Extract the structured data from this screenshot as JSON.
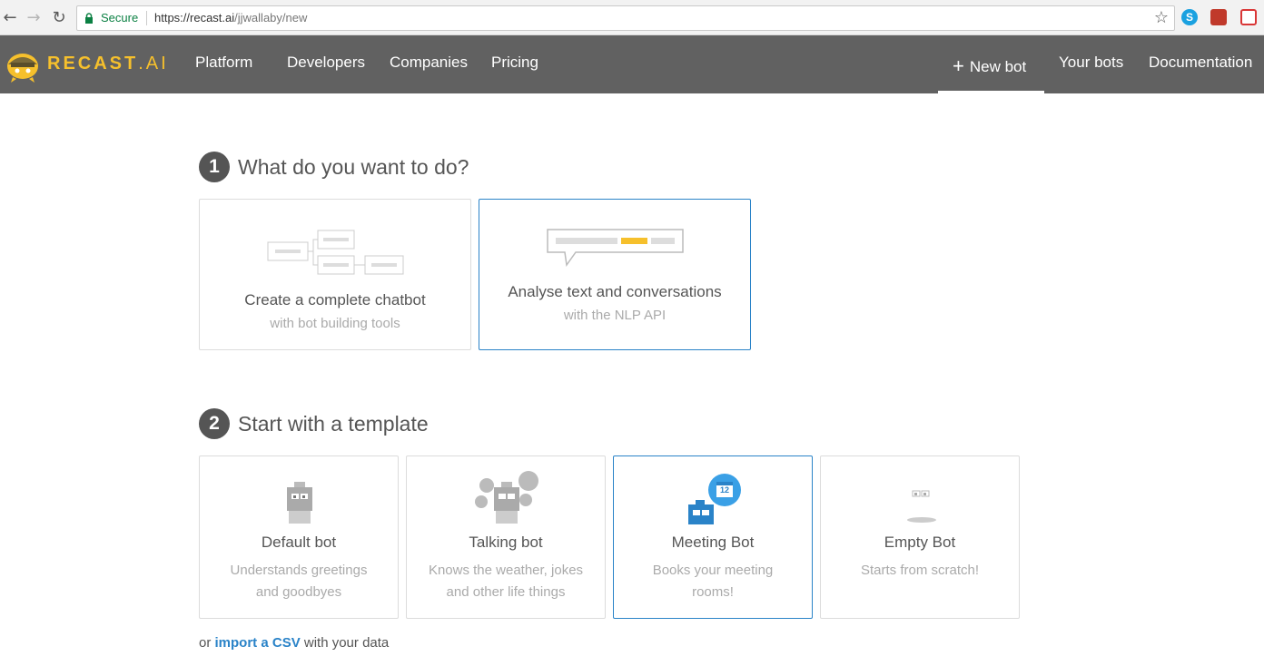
{
  "browser": {
    "secure_label": "Secure",
    "url_host": "https://recast.ai",
    "url_path": "/jjwallaby/new",
    "skype_letter": "S"
  },
  "header": {
    "brand_main": "RECAST",
    "brand_dot": ".",
    "brand_suffix": "AI",
    "nav": {
      "platform": "Platform",
      "developers": "Developers",
      "companies": "Companies",
      "pricing": "Pricing",
      "new_bot": "New bot",
      "your_bots": "Your bots",
      "documentation": "Documentation"
    },
    "accent": "#f6c02c"
  },
  "step1": {
    "number": "1",
    "title": "What do you want to do?",
    "options": [
      {
        "title": "Create a complete chatbot",
        "subtitle": "with bot building tools"
      },
      {
        "title": "Analyse text and conversations",
        "subtitle": "with the NLP API"
      }
    ]
  },
  "step2": {
    "number": "2",
    "title": "Start with a template",
    "templates": [
      {
        "title": "Default bot",
        "line1": "Understands greetings",
        "line2": "and goodbyes"
      },
      {
        "title": "Talking bot",
        "line1": "Knows the weather, jokes",
        "line2": "and other life things"
      },
      {
        "title": "Meeting Bot",
        "line1": "Books your meeting",
        "line2": "rooms!",
        "calendar_day": "12"
      },
      {
        "title": "Empty Bot",
        "line1": "Starts from scratch!",
        "line2": ""
      }
    ]
  },
  "import": {
    "prefix": "or",
    "link": "import a CSV",
    "suffix": "with your data"
  },
  "colors": {
    "selected_border": "#2a83c8",
    "header_bg": "#616161"
  }
}
